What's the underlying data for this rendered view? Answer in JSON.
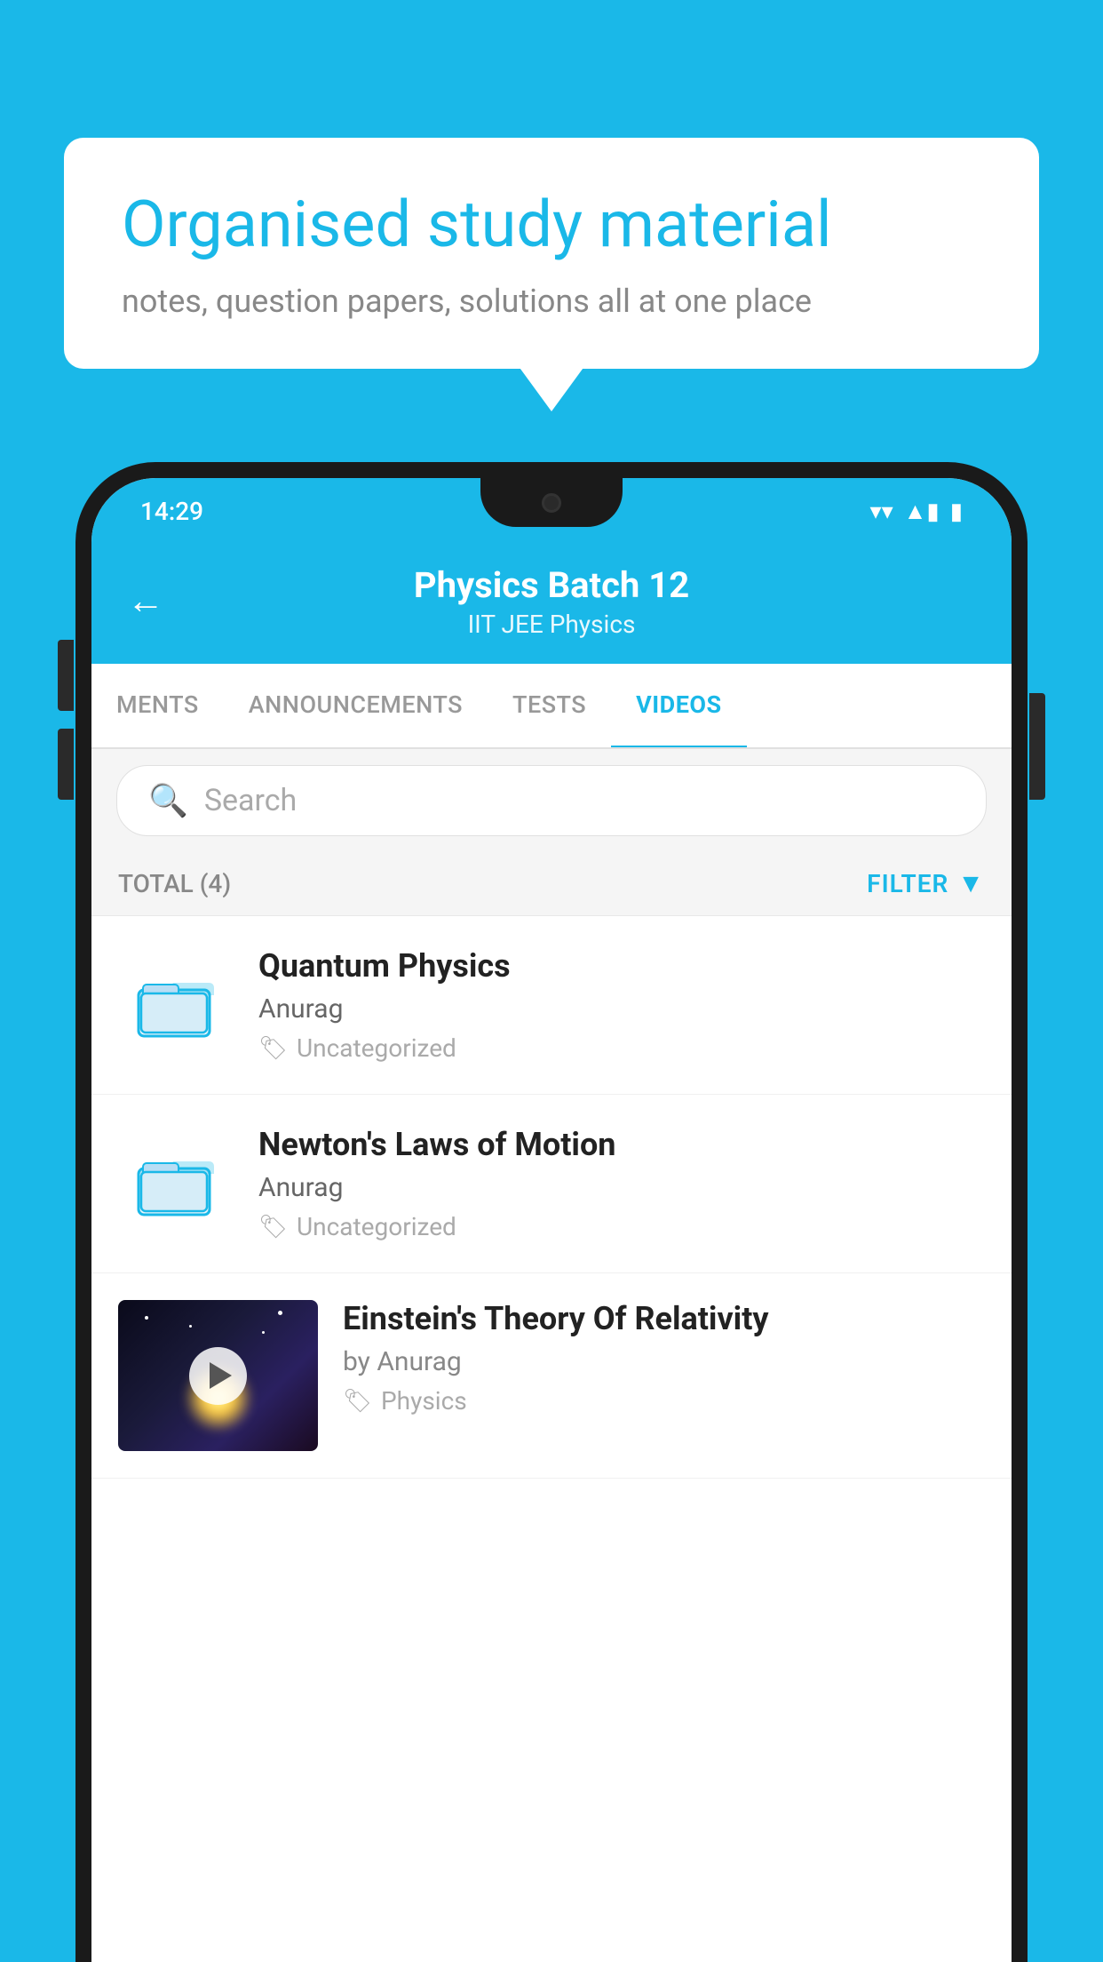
{
  "background_color": "#1ab8e8",
  "speech_bubble": {
    "title": "Organised study material",
    "subtitle": "notes, question papers, solutions all at one place"
  },
  "status_bar": {
    "time": "14:29",
    "wifi": "▼",
    "signal": "▲",
    "battery": "▮"
  },
  "app_header": {
    "back_label": "←",
    "title": "Physics Batch 12",
    "subtitle": "IIT JEE   Physics"
  },
  "tabs": [
    {
      "label": "MENTS",
      "active": false
    },
    {
      "label": "ANNOUNCEMENTS",
      "active": false
    },
    {
      "label": "TESTS",
      "active": false
    },
    {
      "label": "VIDEOS",
      "active": true
    }
  ],
  "search": {
    "placeholder": "Search"
  },
  "filter_bar": {
    "total_label": "TOTAL (4)",
    "filter_label": "FILTER"
  },
  "videos": [
    {
      "title": "Quantum Physics",
      "author": "Anurag",
      "tag": "Uncategorized",
      "has_thumbnail": false
    },
    {
      "title": "Newton's Laws of Motion",
      "author": "Anurag",
      "tag": "Uncategorized",
      "has_thumbnail": false
    },
    {
      "title": "Einstein's Theory Of Relativity",
      "author": "by Anurag",
      "tag": "Physics",
      "has_thumbnail": true
    }
  ]
}
